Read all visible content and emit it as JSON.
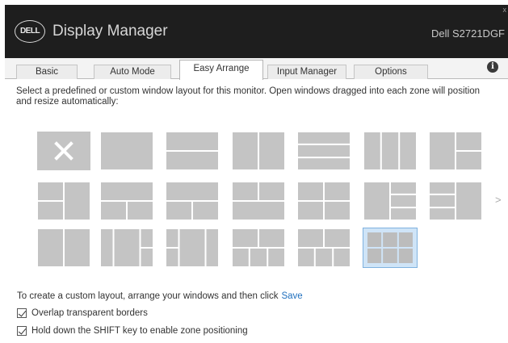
{
  "app": {
    "logo_text": "DELL",
    "title": "Display Manager",
    "monitor": "Dell S2721DGF",
    "close_glyph": "x"
  },
  "tabs": [
    {
      "label": "Basic",
      "active": false
    },
    {
      "label": "Auto Mode",
      "active": false
    },
    {
      "label": "Easy Arrange",
      "active": true
    },
    {
      "label": "Input Manager",
      "active": false
    },
    {
      "label": "Options",
      "active": false
    }
  ],
  "info_icon": "info-icon",
  "description": "Select a predefined or custom window layout for this monitor.  Open windows dragged into each zone will position and resize automatically:",
  "layouts": {
    "rows": [
      [
        "none",
        "full",
        "horizontal-2",
        "vertical-2",
        "horizontal-3",
        "vertical-3",
        "left-plus-right-split"
      ],
      [
        "left-split-plus-right",
        "left-plus-right-split-wide",
        "top-plus-bottom-split",
        "top-split-plus-bottom",
        "grid-2x2",
        "left-plus-right-3-split",
        "right-plus-left-3-split"
      ],
      [
        "left-plus-middle-right",
        "middle-plus-right-split",
        "left-split-plus-middle",
        "grid-left-plus-three",
        "grid-mixed",
        "grid-2x3"
      ]
    ],
    "selected": "grid-2x3",
    "next_glyph": ">",
    "colors": {
      "zone": "#c4c4c4",
      "zone_selected": "#bcbcbc",
      "selection_fill": "#cfe4f7",
      "selection_border": "#7fb2df",
      "gap": "#ffffff"
    }
  },
  "custom": {
    "text": "To create a custom layout, arrange your windows and then click",
    "save_label": "Save"
  },
  "options": [
    {
      "label": "Overlap transparent borders",
      "checked": true
    },
    {
      "label": "Hold down the SHIFT key to enable zone positioning",
      "checked": true
    }
  ]
}
